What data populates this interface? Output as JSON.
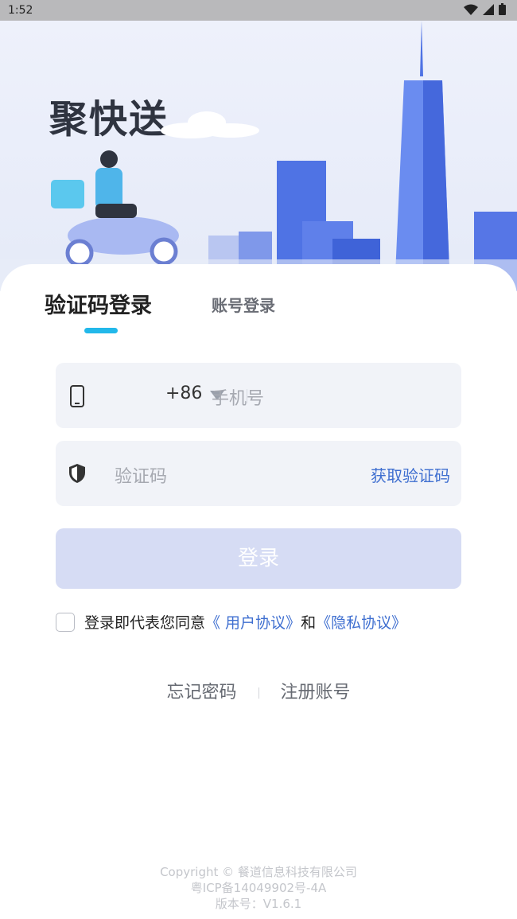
{
  "status_bar": {
    "time": "1:52"
  },
  "app": {
    "logo_text": "聚快送"
  },
  "tabs": {
    "active": "验证码登录",
    "inactive": "账号登录"
  },
  "phone": {
    "country_code": "+86",
    "placeholder": "手机号"
  },
  "code": {
    "placeholder": "验证码",
    "get_code": "获取验证码"
  },
  "login_button": "登录",
  "agreement": {
    "prefix": "登录即代表您同意",
    "user_agreement": "《 用户协议》",
    "and": "和",
    "privacy_policy": "《隐私协议》"
  },
  "links": {
    "forgot": "忘记密码",
    "register": "注册账号"
  },
  "footer": {
    "copyright": "Copyright © 餐道信息科技有限公司",
    "icp": "粤ICP备14049902号-4A",
    "version": "版本号：V1.6.1"
  },
  "colors": {
    "accent": "#3f6fd0",
    "tab_underline": "#22b8ea",
    "button_disabled": "#d6dcf4"
  }
}
